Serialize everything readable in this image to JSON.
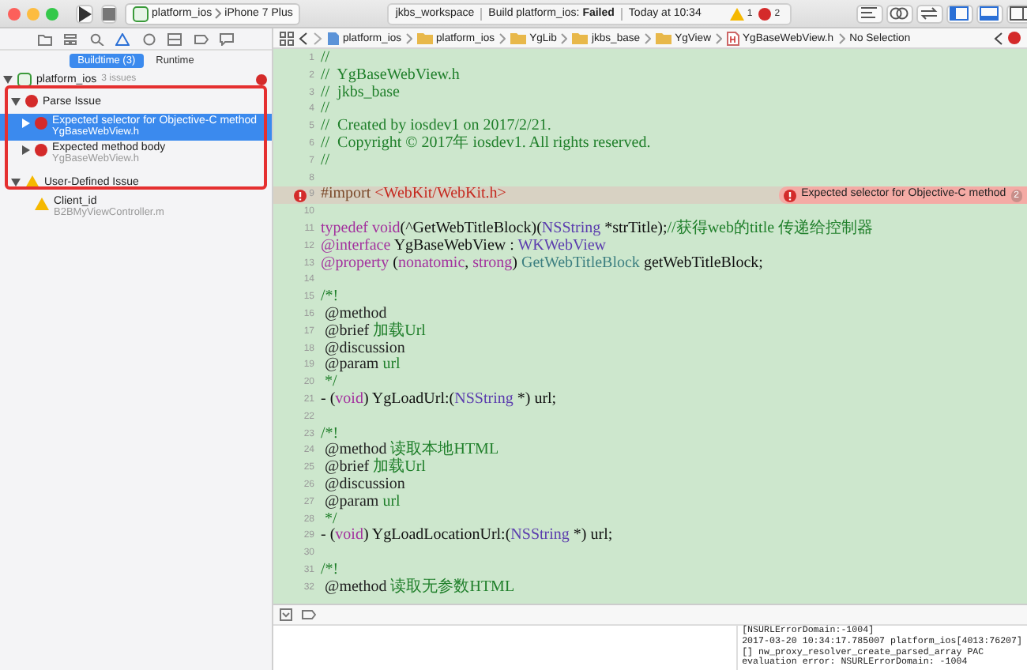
{
  "toolbar": {
    "scheme": "platform_ios",
    "device": "iPhone 7 Plus",
    "status": {
      "workspace": "jkbs_workspace",
      "build": "Build platform_ios:",
      "result": "Failed",
      "time": "Today at 10:34"
    },
    "warnings": "1",
    "errors": "2"
  },
  "jump_bar": {
    "crumbs": [
      {
        "label": "platform_ios",
        "kind": "project"
      },
      {
        "label": "platform_ios",
        "kind": "folder"
      },
      {
        "label": "YgLib",
        "kind": "folder"
      },
      {
        "label": "jkbs_base",
        "kind": "folder"
      },
      {
        "label": "YgView",
        "kind": "folder"
      },
      {
        "label": "YgBaseWebView.h",
        "kind": "header"
      },
      {
        "label": "No Selection",
        "kind": "plain"
      }
    ]
  },
  "navigator": {
    "tabs": [
      {
        "label": "Buildtime (3)",
        "selected": true
      },
      {
        "label": "Runtime",
        "selected": false
      }
    ],
    "project": {
      "title": "platform_ios",
      "count": "3 issues",
      "expanded": true,
      "children": [
        {
          "title": "Parse Issue",
          "kind": "error",
          "expanded": true,
          "children": [
            {
              "title": "Expected selector for Objective-C method",
              "subtitle": "YgBaseWebView.h",
              "kind": "error",
              "expanded": false,
              "selected": true
            },
            {
              "title": "Expected method body",
              "subtitle": "YgBaseWebView.h",
              "kind": "error",
              "expanded": false,
              "selected": false
            }
          ]
        },
        {
          "title": "User-Defined Issue",
          "kind": "warning",
          "expanded": true,
          "children": [
            {
              "title": "Client_id",
              "subtitle": "B2BMyViewController.m",
              "kind": "warning",
              "selected": false
            }
          ]
        }
      ]
    }
  },
  "editor": {
    "lines": [
      {
        "number": "1",
        "tokens": [
          {
            "kind": "comment",
            "text": "//"
          }
        ]
      },
      {
        "number": "2",
        "tokens": [
          {
            "kind": "comment",
            "text": "//  YgBaseWebView.h"
          }
        ]
      },
      {
        "number": "3",
        "tokens": [
          {
            "kind": "comment",
            "text": "//  jkbs_base"
          }
        ]
      },
      {
        "number": "4",
        "tokens": [
          {
            "kind": "comment",
            "text": "//"
          }
        ]
      },
      {
        "number": "5",
        "tokens": [
          {
            "kind": "comment",
            "text": "//  Created by iosdev1 on 2017/2/21."
          }
        ]
      },
      {
        "number": "6",
        "tokens": [
          {
            "kind": "comment",
            "text": "//  Copyright © 2017年 iosdev1. All rights reserved."
          }
        ]
      },
      {
        "number": "7",
        "tokens": [
          {
            "kind": "comment",
            "text": "//"
          }
        ]
      },
      {
        "number": "8"
      },
      {
        "number": "9",
        "tokens": [
          {
            "kind": "preproc",
            "text": "#import "
          },
          {
            "kind": "string",
            "text": "<WebKit/WebKit.h>"
          }
        ],
        "error": {
          "message": "Expected selector for Objective-C method",
          "count": "2"
        }
      },
      {
        "number": "10"
      },
      {
        "number": "11",
        "tokens": [
          {
            "kind": "keyword",
            "text": "typedef"
          },
          {
            "kind": "keyword",
            "text": " void"
          },
          {
            "kind": "plain",
            "text": "(^GetWebTitleBlock)("
          },
          {
            "kind": "type",
            "text": "NSString"
          },
          {
            "kind": "plain",
            "text": " *strTitle);"
          },
          {
            "kind": "comment",
            "text": "//获得web的title 传递给控制器"
          }
        ]
      },
      {
        "number": "12",
        "tokens": [
          {
            "kind": "keyword",
            "text": "@interface"
          },
          {
            "kind": "plain",
            "text": " YgBaseWebView : "
          },
          {
            "kind": "type",
            "text": "WKWebView"
          }
        ]
      },
      {
        "number": "13",
        "tokens": [
          {
            "kind": "keyword",
            "text": "@property"
          },
          {
            "kind": "plain",
            "text": " ("
          },
          {
            "kind": "keyword",
            "text": "nonatomic"
          },
          {
            "kind": "plain",
            "text": ", "
          },
          {
            "kind": "keyword",
            "text": "strong"
          },
          {
            "kind": "plain",
            "text": ") "
          },
          {
            "kind": "typeref",
            "text": "GetWebTitleBlock"
          },
          {
            "kind": "plain",
            "text": " getWebTitleBlock;"
          }
        ]
      },
      {
        "number": "14"
      },
      {
        "number": "15",
        "tokens": [
          {
            "kind": "comment",
            "text": "/*!"
          }
        ]
      },
      {
        "number": "16",
        "tokens": [
          {
            "kind": "doc",
            "text": " @method"
          }
        ]
      },
      {
        "number": "17",
        "tokens": [
          {
            "kind": "doc",
            "text": " @brief "
          },
          {
            "kind": "comment",
            "text": "加载Url"
          }
        ]
      },
      {
        "number": "18",
        "tokens": [
          {
            "kind": "doc",
            "text": " @discussion"
          }
        ]
      },
      {
        "number": "19",
        "tokens": [
          {
            "kind": "doc",
            "text": " @param "
          },
          {
            "kind": "comment",
            "text": "url"
          }
        ]
      },
      {
        "number": "20",
        "tokens": [
          {
            "kind": "comment",
            "text": " */"
          }
        ]
      },
      {
        "number": "21",
        "tokens": [
          {
            "kind": "plain",
            "text": "- ("
          },
          {
            "kind": "keyword",
            "text": "void"
          },
          {
            "kind": "plain",
            "text": ") YgLoadUrl:("
          },
          {
            "kind": "type",
            "text": "NSString"
          },
          {
            "kind": "plain",
            "text": " *) url;"
          }
        ]
      },
      {
        "number": "22"
      },
      {
        "number": "23",
        "tokens": [
          {
            "kind": "comment",
            "text": "/*!"
          }
        ]
      },
      {
        "number": "24",
        "tokens": [
          {
            "kind": "doc",
            "text": " @method "
          },
          {
            "kind": "comment",
            "text": "读取本地HTML"
          }
        ]
      },
      {
        "number": "25",
        "tokens": [
          {
            "kind": "doc",
            "text": " @brief "
          },
          {
            "kind": "comment",
            "text": "加载Url"
          }
        ]
      },
      {
        "number": "26",
        "tokens": [
          {
            "kind": "doc",
            "text": " @discussion"
          }
        ]
      },
      {
        "number": "27",
        "tokens": [
          {
            "kind": "doc",
            "text": " @param "
          },
          {
            "kind": "comment",
            "text": "url"
          }
        ]
      },
      {
        "number": "28",
        "tokens": [
          {
            "kind": "comment",
            "text": " */"
          }
        ]
      },
      {
        "number": "29",
        "tokens": [
          {
            "kind": "plain",
            "text": "- ("
          },
          {
            "kind": "keyword",
            "text": "void"
          },
          {
            "kind": "plain",
            "text": ") YgLoadLocationUrl:("
          },
          {
            "kind": "type",
            "text": "NSString"
          },
          {
            "kind": "plain",
            "text": " *) url;"
          }
        ]
      },
      {
        "number": "30"
      },
      {
        "number": "31",
        "tokens": [
          {
            "kind": "comment",
            "text": "/*!"
          }
        ]
      },
      {
        "number": "32",
        "tokens": [
          {
            "kind": "doc",
            "text": " @method "
          },
          {
            "kind": "comment",
            "text": "读取无参数HTML"
          }
        ]
      }
    ]
  },
  "console": {
    "lines": [
      "[NSURLErrorDomain:-1004]",
      "2017-03-20 10:34:17.785007 platform_ios[4013:76207]",
      "[] nw_proxy_resolver_create_parsed_array PAC",
      "evaluation error: NSURLErrorDomain: -1004"
    ]
  }
}
